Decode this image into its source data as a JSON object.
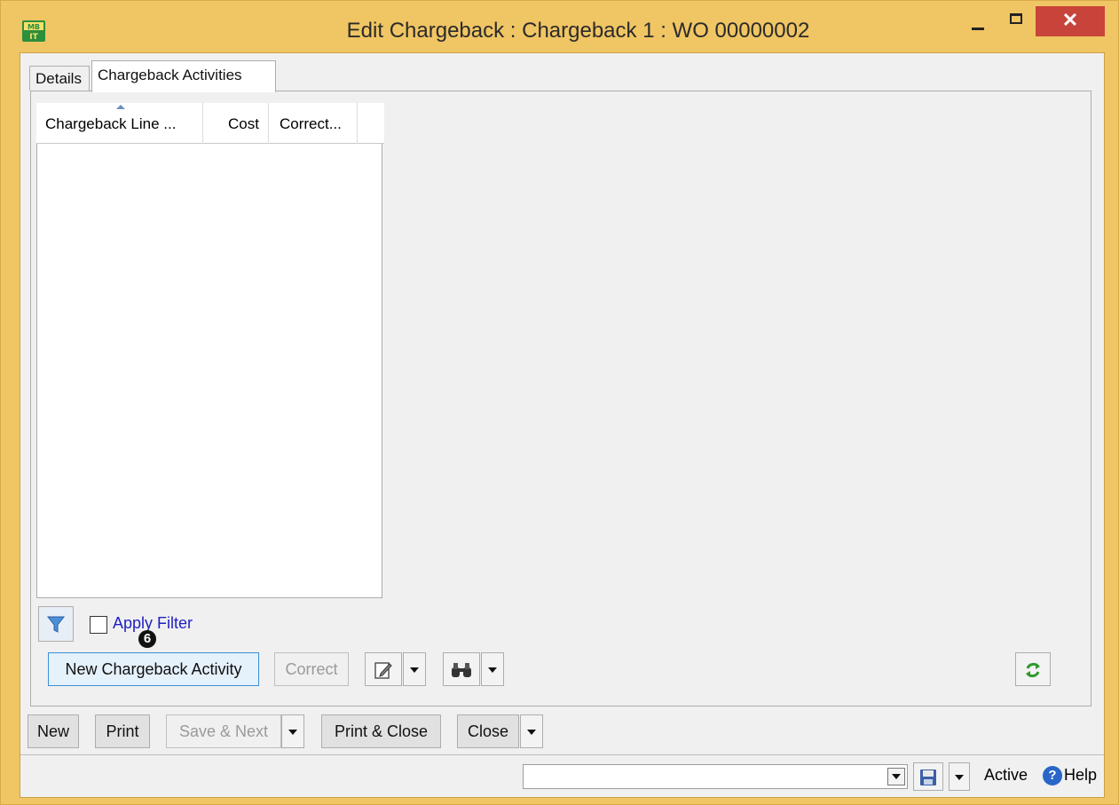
{
  "window": {
    "title": "Edit Chargeback : Chargeback 1 : WO 00000002",
    "app_icon": "mb-app-icon",
    "close_glyph": "✕"
  },
  "tabs": [
    {
      "label": "Details",
      "active": false
    },
    {
      "label": "Chargeback Activities",
      "active": true
    }
  ],
  "grid": {
    "columns": [
      "Chargeback Line ...",
      "Cost",
      "Correct..."
    ],
    "rows": []
  },
  "filter": {
    "label": "Apply Filter",
    "checked": false,
    "icon": "funnel-icon"
  },
  "badge": "6",
  "activity_buttons": {
    "new_activity": "New Chargeback Activity",
    "correct": "Correct",
    "edit_icon": "pencil-icon",
    "find_icon": "binoculars-icon",
    "refresh_icon": "refresh-icon"
  },
  "bottom_buttons": {
    "new": "New",
    "print": "Print",
    "save_next": "Save & Next",
    "print_close": "Print & Close",
    "close": "Close"
  },
  "status": {
    "combo_value": "",
    "state": "Active",
    "help": "Help",
    "save_icon": "floppy-icon"
  },
  "colors": {
    "frame": "#f0c563",
    "close_button": "#c8443a",
    "link": "#1f1fbf",
    "primary_border": "#3c8fd6"
  }
}
